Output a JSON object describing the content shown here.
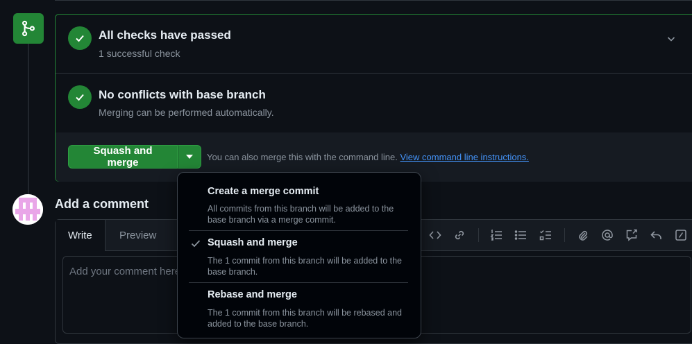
{
  "merge_status": {
    "checks": {
      "title": "All checks have passed",
      "subtitle": "1 successful check"
    },
    "conflicts": {
      "title": "No conflicts with base branch",
      "subtitle": "Merging can be performed automatically."
    },
    "merge_button_label": "Squash and merge",
    "cli_text": "You can also merge this with the command line.",
    "cli_link": "View command line instructions."
  },
  "merge_menu": {
    "items": [
      {
        "title": "Create a merge commit",
        "description": "All commits from this branch will be added to the base branch via a merge commit.",
        "selected": false
      },
      {
        "title": "Squash and merge",
        "description": "The 1 commit from this branch will be added to the base branch.",
        "selected": true
      },
      {
        "title": "Rebase and merge",
        "description": "The 1 commit from this branch will be rebased and added to the base branch.",
        "selected": false
      }
    ]
  },
  "comment": {
    "title": "Add a comment",
    "tabs": [
      "Write",
      "Preview"
    ],
    "active_tab": "Write",
    "placeholder": "Add your comment here...",
    "toolbar_icons": [
      "code-icon",
      "link-icon",
      "ordered-list-icon",
      "unordered-list-icon",
      "task-list-icon",
      "attach-icon",
      "mention-icon",
      "reference-icon",
      "reply-icon",
      "slash-commands-icon"
    ]
  },
  "colors": {
    "success_green": "#238636",
    "background": "#0d1117",
    "link_blue": "#4493f8"
  }
}
